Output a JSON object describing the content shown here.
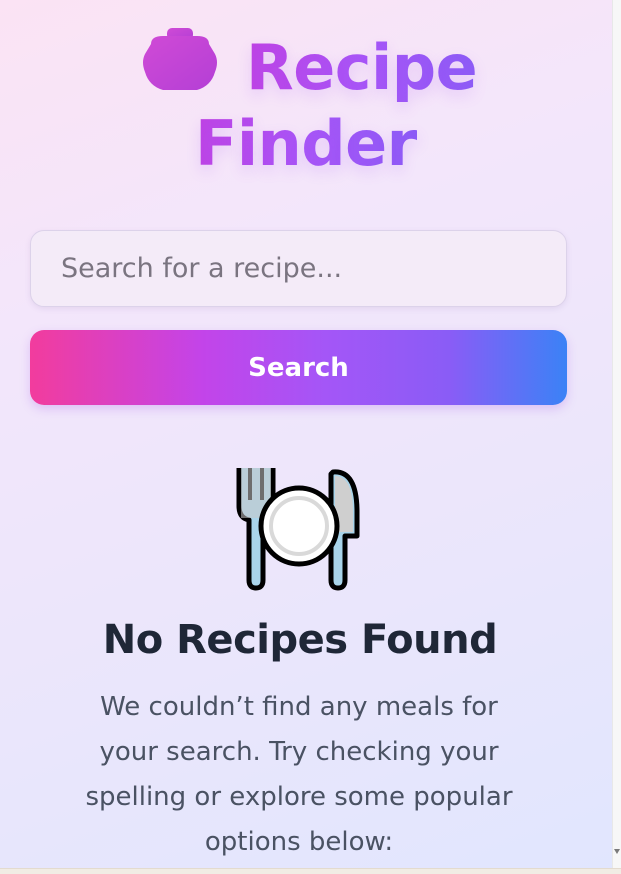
{
  "header": {
    "title_line1": "Recipe",
    "title_line2": "Finder",
    "icon": "cooking-pot-icon"
  },
  "search": {
    "placeholder": "Search for a recipe...",
    "value": "",
    "button_label": "Search"
  },
  "empty_state": {
    "icon": "fork-knife-plate-icon",
    "title": "No Recipes Found",
    "message": "We couldn’t find any meals for your search. Try checking your spelling or explore some popular options below:"
  },
  "colors": {
    "title_gradient_start": "#c042e3",
    "title_gradient_end": "#8b5cf6",
    "button_gradient_start": "#f23c9d",
    "button_gradient_mid": "#a456f7",
    "button_gradient_end": "#3b82f6",
    "heading_text": "#1f2737",
    "body_text": "#4a5263"
  }
}
